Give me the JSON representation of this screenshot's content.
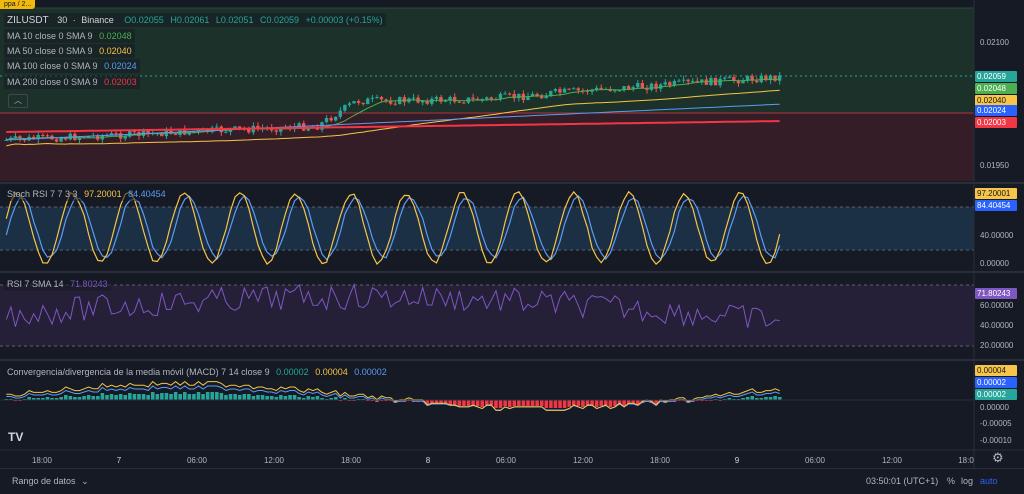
{
  "top_badge": "ppa / 2...",
  "header": {
    "symbol": "ZILUSDT",
    "interval": "30",
    "exchange": "Binance",
    "o": "O0.02055",
    "h": "H0.02061",
    "l": "L0.02051",
    "c": "C0.02059",
    "change": "+0.00003 (+0.15%)"
  },
  "ma_legend": [
    {
      "label": "MA 10 close 0 SMA 9",
      "value": "0.02048",
      "color": "#4caf50"
    },
    {
      "label": "MA 50 close 0 SMA 9",
      "value": "0.02040",
      "color": "#f7c548"
    },
    {
      "label": "MA 100 close 0 SMA 9",
      "value": "0.02024",
      "color": "#5b9cf6"
    },
    {
      "label": "MA 200 close 0 SMA 9",
      "value": "0.02003",
      "color": "#f23645"
    }
  ],
  "price_axis": {
    "ticks": [
      "0.02100",
      "0.01950"
    ],
    "tags": [
      {
        "value": "0.02059",
        "bg": "#26a69a",
        "fg": "#ffffff"
      },
      {
        "value": "0.02048",
        "bg": "#4caf50",
        "fg": "#ffffff"
      },
      {
        "value": "0.02040",
        "bg": "#f7c548",
        "fg": "#131722"
      },
      {
        "value": "0.02024",
        "bg": "#2962ff",
        "fg": "#ffffff"
      },
      {
        "value": "0.02003",
        "bg": "#f23645",
        "fg": "#ffffff"
      }
    ]
  },
  "stoch_rsi": {
    "label": "Stoch RSI 7 7 3 3",
    "k": "97.20001",
    "d": "84.40454",
    "k_color": "#f7c548",
    "d_color": "#5b9cf6",
    "ticks": [
      "40.00000",
      "0.00000"
    ]
  },
  "rsi": {
    "label": "RSI 7 SMA 14",
    "value": "71.80243",
    "color": "#7e57c2",
    "ticks": [
      "60.00000",
      "40.00000",
      "20.00000"
    ]
  },
  "macd": {
    "label": "Convergencia/divergencia de la media móvil (MACD) 7 14 close 9",
    "hist": "0.00002",
    "macd": "0.00004",
    "signal": "0.00002",
    "ticks": [
      "0.00000",
      "-0.00005",
      "-0.00010"
    ],
    "tags": [
      {
        "value": "0.00004",
        "bg": "#f7c548",
        "fg": "#131722"
      },
      {
        "value": "0.00002",
        "bg": "#2962ff",
        "fg": "#ffffff"
      },
      {
        "value": "0.00002",
        "bg": "#26a69a",
        "fg": "#ffffff"
      }
    ]
  },
  "time_axis": [
    "18:00",
    "7",
    "06:00",
    "12:00",
    "18:00",
    "8",
    "06:00",
    "12:00",
    "18:00",
    "9",
    "06:00",
    "12:00",
    "18:0"
  ],
  "footer": {
    "range": "Rango de datos",
    "clock": "03:50:01 (UTC+1)",
    "percent": "%",
    "log": "log",
    "auto": "auto"
  },
  "icons": {
    "logo": "tradingview-logo-icon",
    "settings": "gear-icon",
    "collapse": "chevron-up-icon"
  },
  "colors": {
    "bull": "#26a69a",
    "bear": "#ef5350",
    "background": "#161a25"
  }
}
